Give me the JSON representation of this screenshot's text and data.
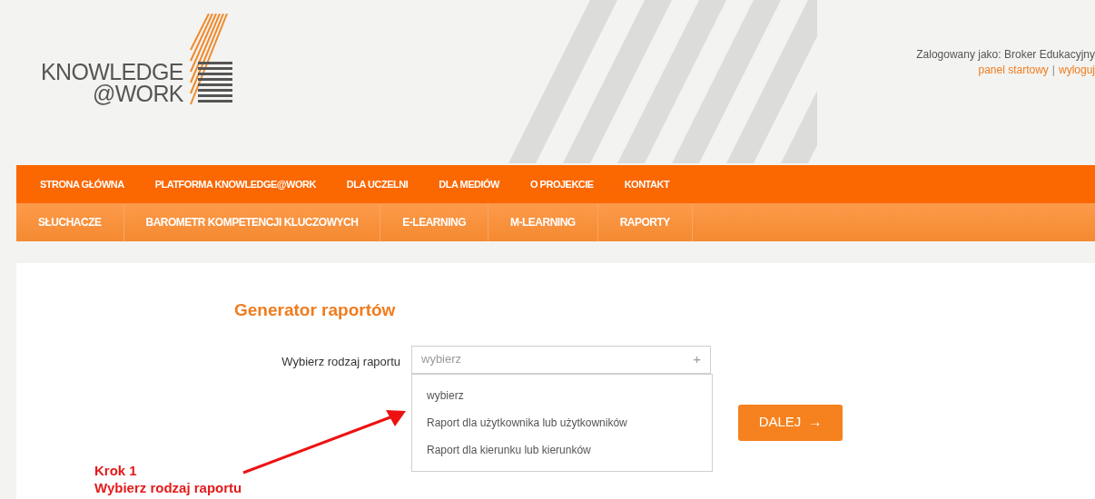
{
  "header": {
    "logo": {
      "line1": "KNOWLEDGE",
      "line2": "@WORK"
    },
    "user": {
      "text": "Zalogowany jako: Broker Edukacyjny",
      "links": [
        "panel startowy",
        "wyloguj"
      ],
      "separator": "|"
    }
  },
  "main_nav": [
    "STRONA GŁÓWNA",
    "PLATFORMA KNOWLEDGE@WORK",
    "DLA UCZELNI",
    "DLA MEDIÓW",
    "O PROJEKCIE",
    "KONTAKT"
  ],
  "sub_nav": [
    "SŁUCHACZE",
    "BAROMETR KOMPETENCJI KLUCZOWYCH",
    "E-LEARNING",
    "M-LEARNING",
    "RAPORTY"
  ],
  "content": {
    "title": "Generator raportów",
    "field": {
      "label": "Wybierz rodzaj raportu",
      "placeholder": "wybierz",
      "toggle": "+",
      "expanded": true,
      "options": [
        "wybierz",
        "Raport dla użytkownika lub użytkowników",
        "Raport dla kierunku lub kierunków"
      ]
    },
    "button": {
      "label": "DALEJ",
      "arrow": "→"
    }
  },
  "annotation": {
    "lines": [
      "Krok 1",
      "Wybierz rodzaj raportu"
    ]
  }
}
